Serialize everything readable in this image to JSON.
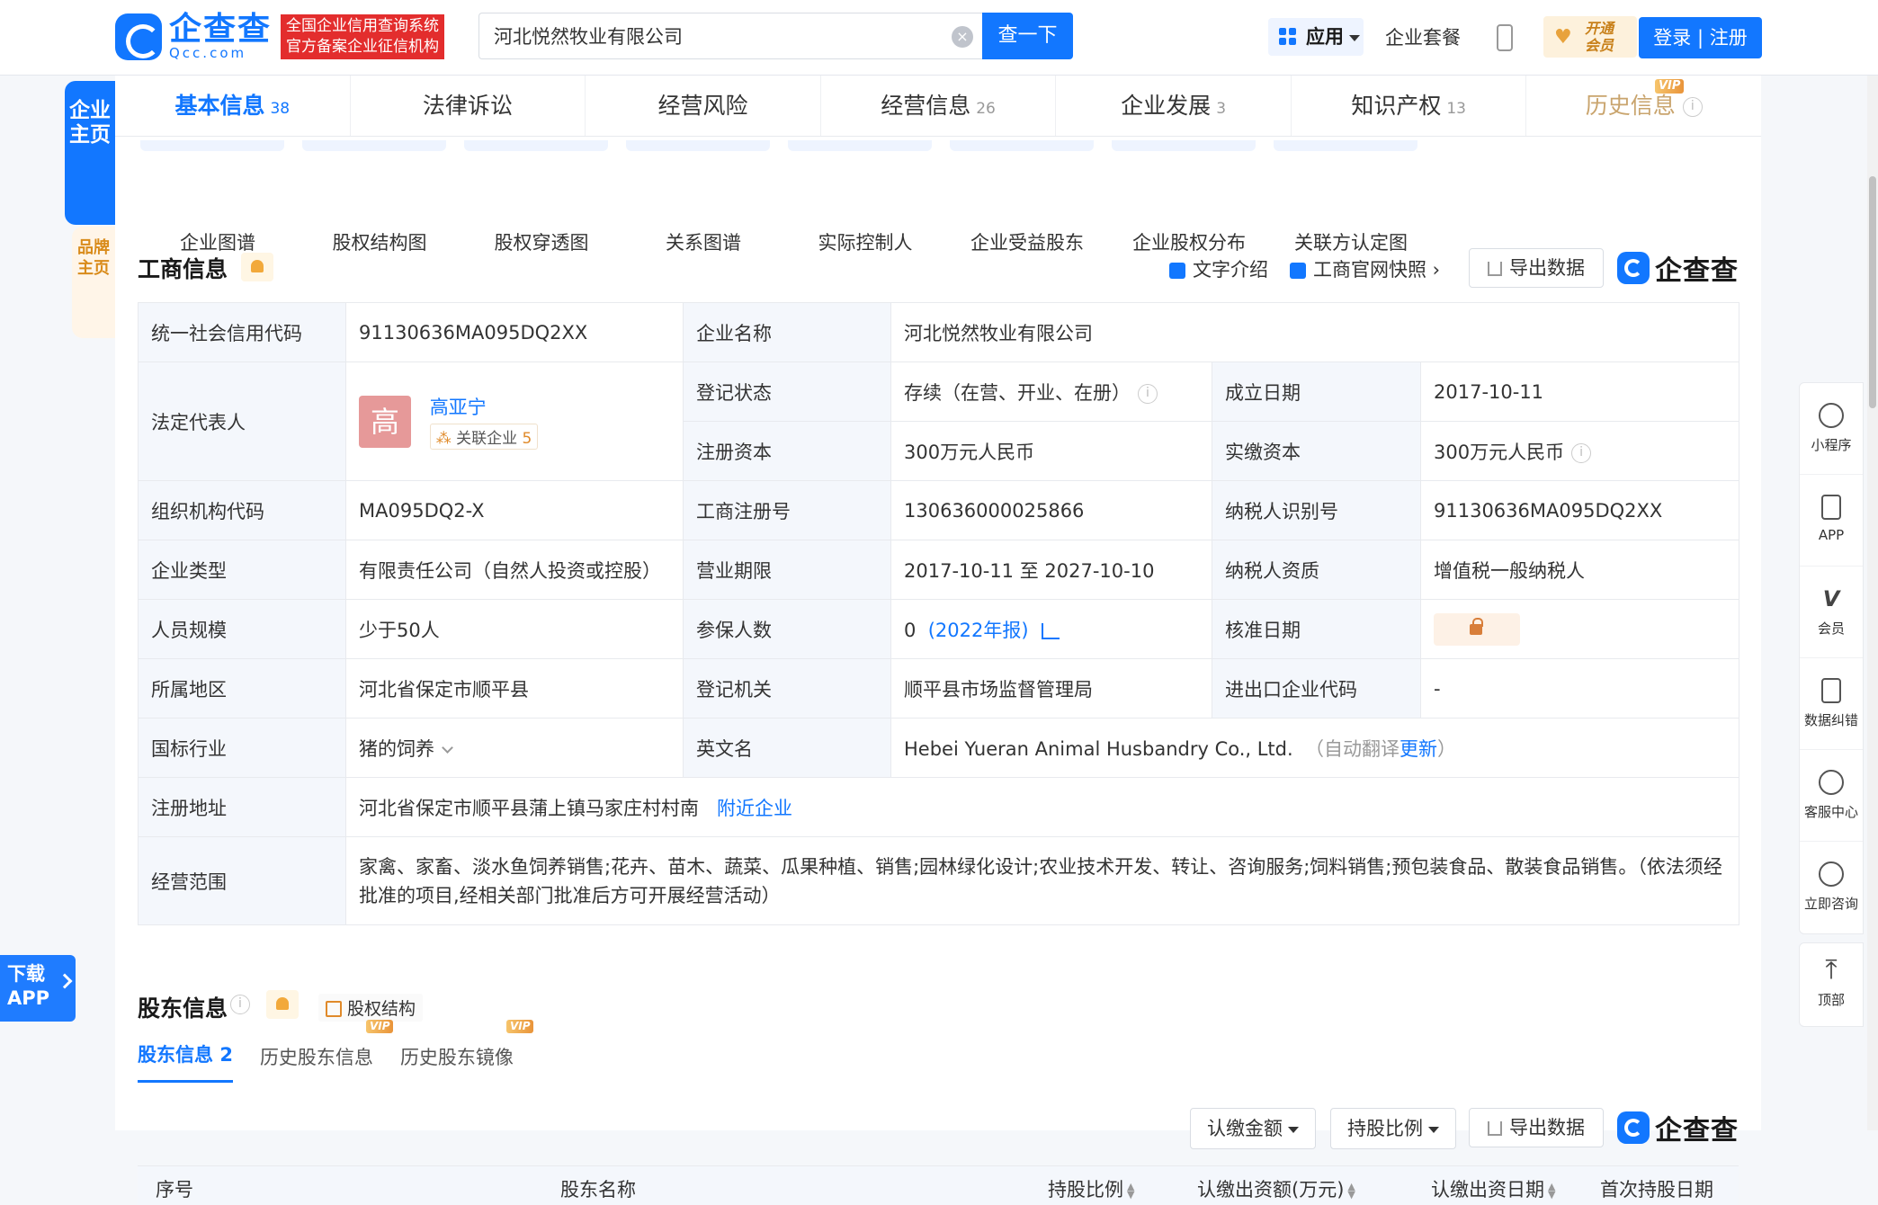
{
  "header": {
    "logo_text": "企查查",
    "logo_sub": "Qcc.com",
    "logo_tag_line1": "全国企业信用查询系统",
    "logo_tag_line2": "官方备案企业征信机构",
    "search_value": "河北悦然牧业有限公司",
    "search_button": "查一下",
    "app_menu": "应用",
    "suite_link": "企业套餐",
    "vip_open_line1": "开通",
    "vip_open_line2": "会员",
    "login": "登录 | 注册"
  },
  "left_float": {
    "main_tab": "企业主页",
    "brand_tab": "品牌主页",
    "download_line1": "下载",
    "download_line2": "APP"
  },
  "right_toolbar": {
    "items": [
      "小程序",
      "APP",
      "会员",
      "数据纠错",
      "客服中心",
      "立即咨询"
    ],
    "top": "顶部"
  },
  "tabs": [
    {
      "label": "基本信息",
      "count": "38"
    },
    {
      "label": "法律诉讼",
      "count": ""
    },
    {
      "label": "经营风险",
      "count": ""
    },
    {
      "label": "经营信息",
      "count": "26"
    },
    {
      "label": "企业发展",
      "count": "3"
    },
    {
      "label": "知识产权",
      "count": "13"
    },
    {
      "label": "历史信息",
      "count": ""
    }
  ],
  "vip_tag": "VIP",
  "graph_links": [
    "企业图谱",
    "股权结构图",
    "股权穿透图",
    "关系图谱",
    "实际控制人",
    "企业受益股东",
    "企业股权分布",
    "关联方认定图"
  ],
  "business": {
    "title": "工商信息",
    "text_intro": "文字介绍",
    "snapshot": "工商官网快照",
    "export": "导出数据",
    "brand": "企查查",
    "rows": {
      "credit_code_label": "统一社会信用代码",
      "credit_code": "91130636MA095DQ2XX",
      "name_label": "企业名称",
      "name": "河北悦然牧业有限公司",
      "legal_rep_label": "法定代表人",
      "legal_rep_avatar": "高",
      "legal_rep": "高亚宁",
      "related_label": "关联企业",
      "related_count": "5",
      "status_label": "登记状态",
      "status": "存续（在营、开业、在册）",
      "found_label": "成立日期",
      "found": "2017-10-11",
      "reg_capital_label": "注册资本",
      "reg_capital": "300万元人民币",
      "paid_capital_label": "实缴资本",
      "paid_capital": "300万元人民币",
      "org_code_label": "组织机构代码",
      "org_code": "MA095DQ2-X",
      "reg_no_label": "工商注册号",
      "reg_no": "130636000025866",
      "tax_id_label": "纳税人识别号",
      "tax_id": "91130636MA095DQ2XX",
      "type_label": "企业类型",
      "type": "有限责任公司（自然人投资或控股）",
      "term_label": "营业期限",
      "term": "2017-10-11 至 2027-10-10",
      "tax_qual_label": "纳税人资质",
      "tax_qual": "增值税一般纳税人",
      "staff_label": "人员规模",
      "staff": "少于50人",
      "insured_label": "参保人数",
      "insured": "0",
      "insured_year": "(2022年报)",
      "approve_label": "核准日期",
      "region_label": "所属地区",
      "region": "河北省保定市顺平县",
      "authority_label": "登记机关",
      "authority": "顺平县市场监督管理局",
      "import_label": "进出口企业代码",
      "import": "-",
      "industry_label": "国标行业",
      "industry": "猪的饲养",
      "en_name_label": "英文名",
      "en_name": "Hebei Yueran Animal Husbandry Co., Ltd.",
      "auto_trans_open": "（自动翻译",
      "auto_trans_update": "更新",
      "auto_trans_close": "）",
      "address_label": "注册地址",
      "address": "河北省保定市顺平县蒲上镇马家庄村村南",
      "nearby": "附近企业",
      "scope_label": "经营范围",
      "scope": "家禽、家畜、淡水鱼饲养销售;花卉、苗木、蔬菜、瓜果种植、销售;园林绿化设计;农业技术开发、转让、咨询服务;饲料销售;预包装食品、散装食品销售。（依法须经批准的项目,经相关部门批准后方可开展经营活动）"
    }
  },
  "shareholders": {
    "title": "股东信息",
    "equity_link": "股权结构",
    "tabs": [
      {
        "label": "股东信息",
        "count": "2"
      },
      {
        "label": "历史股东信息",
        "count": ""
      },
      {
        "label": "历史股东镜像",
        "count": ""
      }
    ],
    "amount_dd": "认缴金额",
    "ratio_dd": "持股比例",
    "export": "导出数据",
    "brand": "企查查",
    "columns": [
      "序号",
      "股东名称",
      "持股比例",
      "认缴出资额(万元)",
      "认缴出资日期",
      "首次持股日期"
    ]
  }
}
